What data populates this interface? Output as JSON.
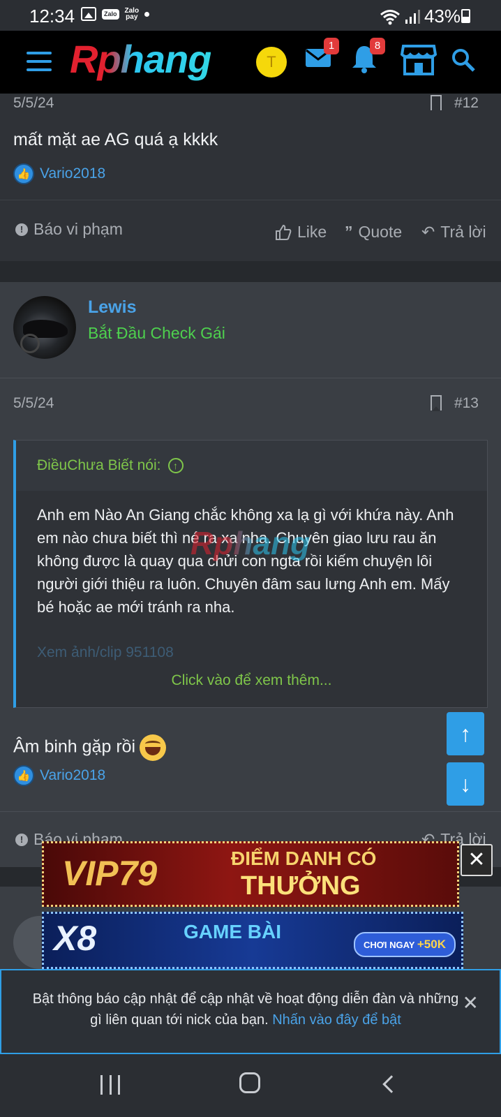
{
  "status_bar": {
    "time": "12:34",
    "zalo": "Zalo",
    "zalopay": "Zalo\npay",
    "battery": "43%"
  },
  "header": {
    "logo": "Rphang",
    "avatar_letter": "T",
    "messages_badge": "1",
    "alerts_badge": "8"
  },
  "post_prev": {
    "date": "5/5/24",
    "number": "#12",
    "text": "mất mặt ae AG quá ạ kkkk",
    "liked_by": "Vario2018",
    "actions": {
      "report": "Báo vi phạm",
      "like": "Like",
      "quote": "Quote",
      "reply": "Trả lời"
    }
  },
  "post_main": {
    "username": "Lewis",
    "user_title": "Bắt Đầu Check Gái",
    "date": "5/5/24",
    "number": "#13",
    "quote": {
      "author": "ĐiềuChưa Biết nói:",
      "body": "Anh em Nào An Giang chắc không xa lạ gì với khứa này. Anh em nào chưa biết thì né ra xa nha. Chuyên giao lưu rau ăn không được là quay qua chửi con ngta rồi kiếm chuyện lôi người giới thiệu ra luôn. Chuyên đâm sau lưng Anh em. Mấy bé hoặc ae mới tránh ra nha.",
      "faded_line": "Xem ảnh/clip 951108",
      "expand": "Click vào để xem thêm..."
    },
    "text": "Âm binh gặp rồi",
    "liked_by": "Vario2018",
    "actions": {
      "report": "Báo vi phạm",
      "reply": "Trả lời"
    }
  },
  "watermark": "Rphang",
  "ads": {
    "ad1_brand": "VIP79",
    "ad1_line1": "ĐIỂM DANH CÓ",
    "ad1_line2": "THƯỞNG",
    "ad2_brand": "X8",
    "ad2_line1": "GAME BÀI",
    "ad2_pill_a": "CHƠI NGAY",
    "ad2_pill_b": "+50K"
  },
  "notification": {
    "text": "Bật thông báo cập nhật để cập nhật về hoạt động diễn đàn và những gì liên quan tới nick của bạn.",
    "link": "Nhấn vào đây để bật"
  }
}
